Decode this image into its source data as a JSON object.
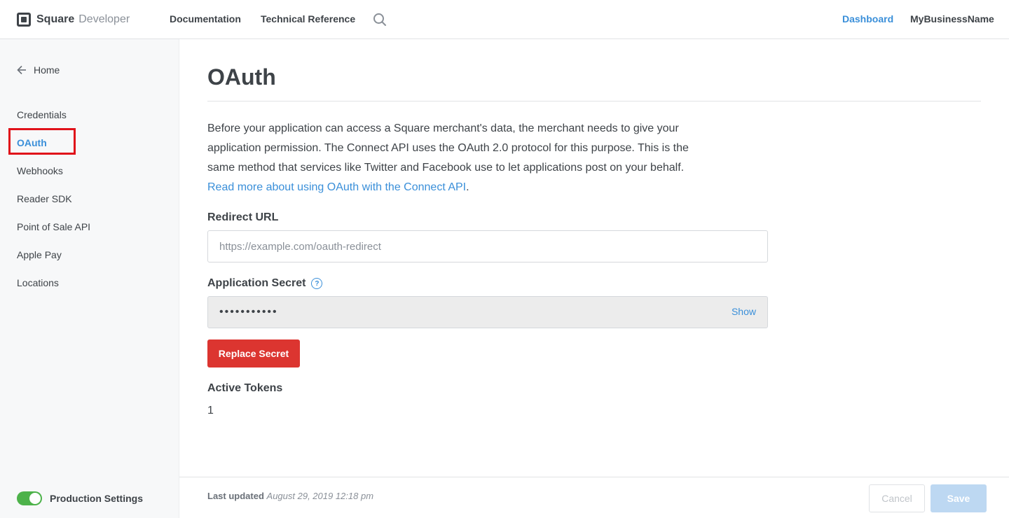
{
  "header": {
    "brand_name": "Square",
    "brand_sub": "Developer",
    "nav_documentation": "Documentation",
    "nav_technical_reference": "Technical Reference",
    "nav_dashboard": "Dashboard",
    "nav_business": "MyBusinessName"
  },
  "sidebar": {
    "home": "Home",
    "items": [
      {
        "label": "Credentials"
      },
      {
        "label": "OAuth",
        "active": true
      },
      {
        "label": "Webhooks"
      },
      {
        "label": "Reader SDK"
      },
      {
        "label": "Point of Sale API"
      },
      {
        "label": "Apple Pay"
      },
      {
        "label": "Locations"
      }
    ],
    "production_settings": "Production Settings",
    "production_enabled": true
  },
  "main": {
    "title": "OAuth",
    "intro_text": "Before your application can access a Square merchant's data, the merchant needs to give your application permission. The Connect API uses the OAuth 2.0 protocol for this purpose. This is the same method that services like Twitter and Facebook use to let applications post on your behalf. ",
    "intro_link": "Read more about using OAuth with the Connect API",
    "intro_end": ".",
    "redirect_label": "Redirect URL",
    "redirect_placeholder": "https://example.com/oauth-redirect",
    "redirect_value": "",
    "secret_label": "Application Secret",
    "secret_help_icon": "?",
    "secret_masked": "•••••••••••",
    "secret_show": "Show",
    "replace_secret": "Replace Secret",
    "active_tokens_label": "Active Tokens",
    "active_tokens_value": "1"
  },
  "footer": {
    "last_updated_label": "Last updated",
    "last_updated_date": "August 29, 2019 12:18 pm",
    "cancel": "Cancel",
    "save": "Save"
  },
  "colors": {
    "accent": "#3a8fd9",
    "danger": "#dc3530",
    "toggle_on": "#4db24a",
    "highlight_box": "#e0121a"
  },
  "icons": [
    "square-logo-icon",
    "search-icon",
    "arrow-left-icon",
    "help-icon",
    "toggle-icon",
    "annotation-arrow-icon"
  ]
}
